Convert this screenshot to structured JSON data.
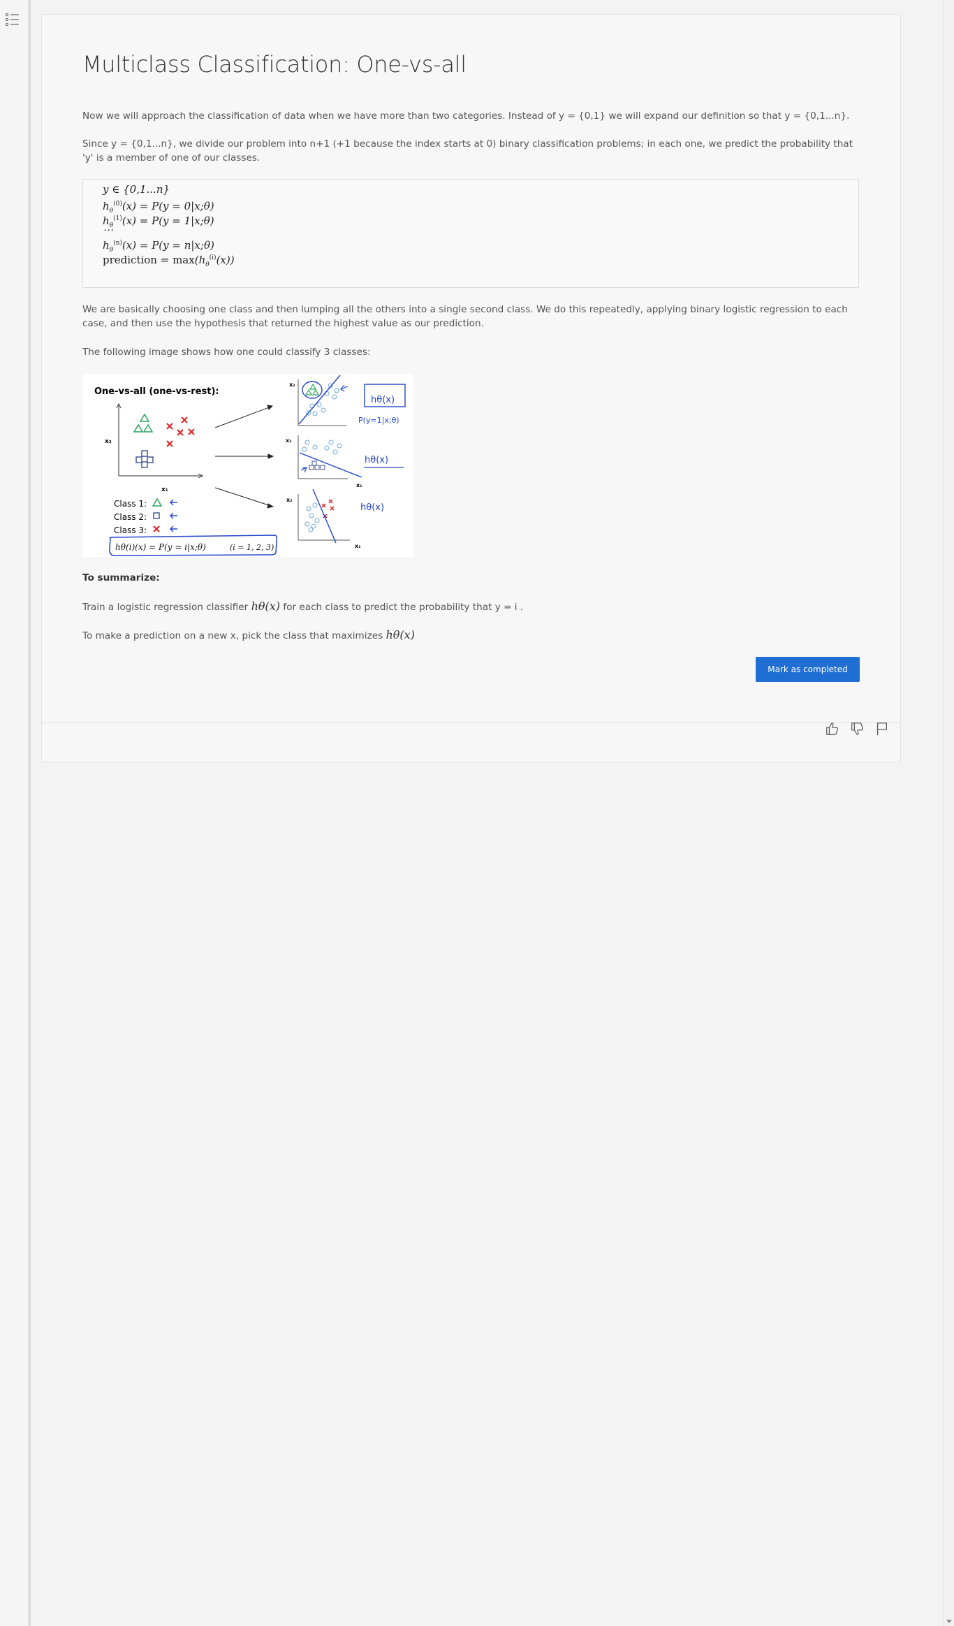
{
  "sidebar": {
    "toc_icon": "list-outline-icon"
  },
  "lesson": {
    "title": "Multiclass Classification: One-vs-all",
    "p1": "Now we will approach the classification of data when we have more than two categories. Instead of y = {0,1} we will expand our definition so that y = {0,1...n}.",
    "p2": "Since y = {0,1...n}, we divide our problem into n+1 (+1 because the index starts at 0) binary classification problems; in each one, we predict the probability that 'y' is a member of one of our classes.",
    "math": {
      "line1": "y ∈ {0,1...n}",
      "line2": "hθ(0)(x) = P(y = 0|x;θ)",
      "line3": "hθ(1)(x) = P(y = 1|x;θ)",
      "line4": "⋯",
      "line5": "hθ(n)(x) = P(y = n|x;θ)",
      "line6": "prediction = max(hθ(i)(x))"
    },
    "p3": "We are basically choosing one class and then lumping all the others into a single second class. We do this repeatedly, applying binary logistic regression to each case, and then use the hypothesis that returned the highest value as our prediction.",
    "p4": "The following image shows how one could classify 3 classes:",
    "figure": {
      "heading": "One-vs-all (one-vs-rest):",
      "class1": "Class 1:",
      "class2": "Class 2:",
      "class3": "Class 3:",
      "x1": "x₁",
      "x2": "x₂",
      "hyp": "hθ(i)(x) = P(y = i|x;θ)",
      "range": "(i = 1, 2, 3)",
      "note1": "hθ(x)",
      "note_p": "P(y=1|x;θ)",
      "note2": "hθ(x)",
      "note3": "hθ(x)"
    },
    "summarize": "To summarize:",
    "p5_pre": "Train a logistic regression classifier",
    "p5_formula": "hθ(x)",
    "p5_post": "for each class to predict the probability that  y = i .",
    "p6_pre": "To make a prediction on a new x, pick the class that maximizes",
    "p6_formula": "hθ(x)",
    "complete_button": "Mark as completed"
  },
  "footer": {
    "like_icon": "thumbs-up-icon",
    "dislike_icon": "thumbs-down-icon",
    "flag_icon": "flag-icon"
  },
  "colors": {
    "primary": "#1f6ed4",
    "figure_blue": "#2244cc",
    "green": "#2aa55c",
    "red": "#e02020",
    "light_blue": "#6fa8dc"
  }
}
